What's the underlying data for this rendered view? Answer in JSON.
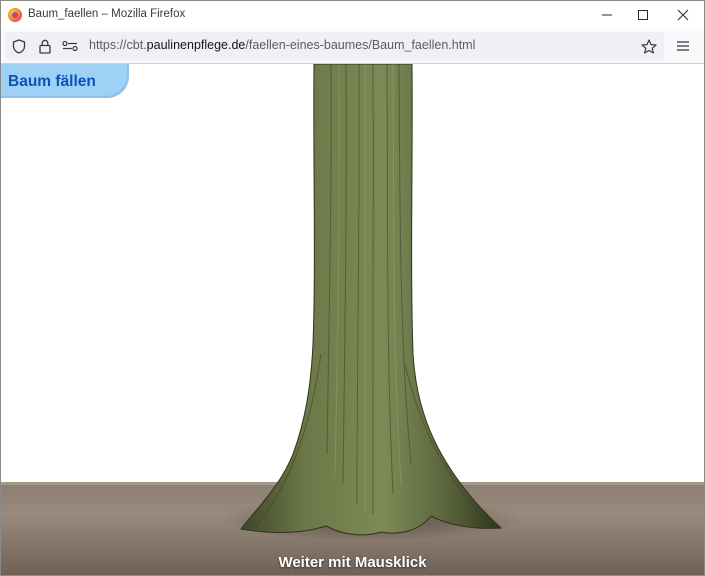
{
  "window": {
    "title": "Baum_faellen – Mozilla Firefox"
  },
  "navbar": {
    "url_prefix": "https://cbt.",
    "url_domain": "paulinenpflege.de",
    "url_path": "/faellen-eines-baumes/Baum_faellen.html"
  },
  "page": {
    "badge_label": "Baum fällen",
    "caption": "Weiter mit Mausklick"
  },
  "icons": {
    "browser_logo": "firefox-logo-icon",
    "minimize": "minimize-icon",
    "maximize": "maximize-icon",
    "close": "close-icon",
    "tracking": "shield-icon",
    "security": "lock-icon",
    "permissions": "permissions-icon",
    "bookmark": "star-icon",
    "menu": "hamburger-menu-icon"
  },
  "colors": {
    "badge_bg": "#9fd0f6",
    "badge_text": "#0b54b8",
    "ground": "#8d7e72",
    "trunk": "#5f6a3e"
  }
}
